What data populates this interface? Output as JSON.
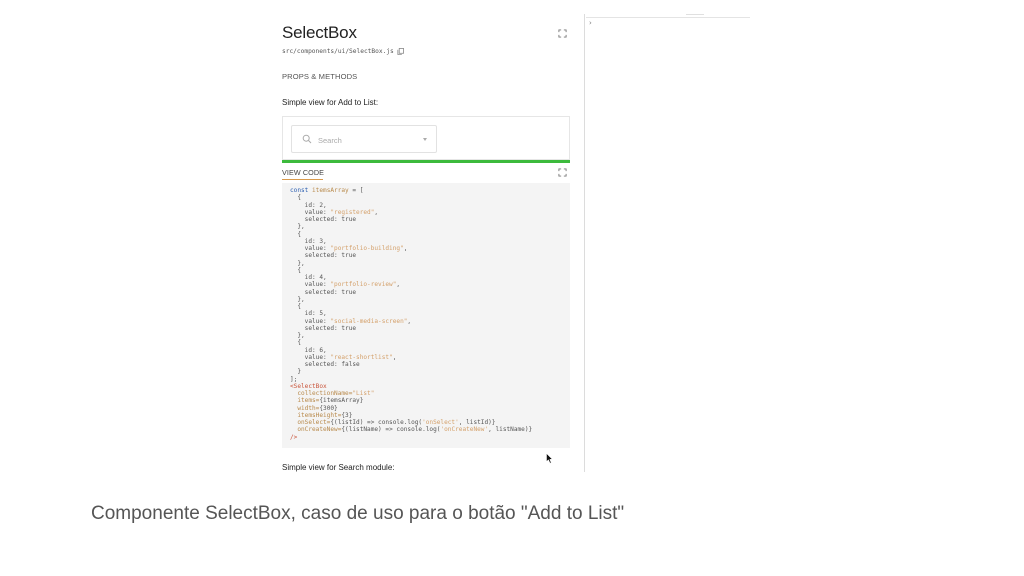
{
  "screenshot": {
    "component_title": "SelectBox",
    "source_path": "src/components/ui/SelectBox.js",
    "props_label": "PROPS & METHODS",
    "example_title": "Simple view for Add to List:",
    "preview": {
      "search_placeholder": "Search"
    },
    "view_code_label": "VIEW CODE",
    "code_lines": [
      [
        {
          "t": "const ",
          "c": "kw"
        },
        {
          "t": "itemsArray",
          "c": "var"
        },
        {
          "t": " = ["
        }
      ],
      [
        {
          "t": "  {"
        }
      ],
      [
        {
          "t": "    id: 2,"
        }
      ],
      [
        {
          "t": "    value: "
        },
        {
          "t": "\"registered\"",
          "c": "str"
        },
        {
          "t": ","
        }
      ],
      [
        {
          "t": "    selected: true"
        }
      ],
      [
        {
          "t": "  },"
        }
      ],
      [
        {
          "t": "  {"
        }
      ],
      [
        {
          "t": "    id: 3,"
        }
      ],
      [
        {
          "t": "    value: "
        },
        {
          "t": "\"portfolio-building\"",
          "c": "str"
        },
        {
          "t": ","
        }
      ],
      [
        {
          "t": "    selected: true"
        }
      ],
      [
        {
          "t": "  },"
        }
      ],
      [
        {
          "t": "  {"
        }
      ],
      [
        {
          "t": "    id: 4,"
        }
      ],
      [
        {
          "t": "    value: "
        },
        {
          "t": "\"portfolio-review\"",
          "c": "str"
        },
        {
          "t": ","
        }
      ],
      [
        {
          "t": "    selected: true"
        }
      ],
      [
        {
          "t": "  },"
        }
      ],
      [
        {
          "t": "  {"
        }
      ],
      [
        {
          "t": "    id: 5,"
        }
      ],
      [
        {
          "t": "    value: "
        },
        {
          "t": "\"social-media-screen\"",
          "c": "str"
        },
        {
          "t": ","
        }
      ],
      [
        {
          "t": "    selected: true"
        }
      ],
      [
        {
          "t": "  },"
        }
      ],
      [
        {
          "t": "  {"
        }
      ],
      [
        {
          "t": "    id: 6,"
        }
      ],
      [
        {
          "t": "    value: "
        },
        {
          "t": "\"react-shortlist\"",
          "c": "str"
        },
        {
          "t": ","
        }
      ],
      [
        {
          "t": "    selected: false"
        }
      ],
      [
        {
          "t": "  }"
        }
      ],
      [
        {
          "t": "];"
        }
      ],
      [
        {
          "t": "<SelectBox",
          "c": "tag"
        }
      ],
      [
        {
          "t": "  collectionName=",
          "c": "attr"
        },
        {
          "t": "\"List\"",
          "c": "str"
        }
      ],
      [
        {
          "t": "  items=",
          "c": "attr"
        },
        {
          "t": "{itemsArray}"
        }
      ],
      [
        {
          "t": "  width=",
          "c": "attr"
        },
        {
          "t": "{300}"
        }
      ],
      [
        {
          "t": "  itemsHeight=",
          "c": "attr"
        },
        {
          "t": "{3}"
        }
      ],
      [
        {
          "t": "  onSelect=",
          "c": "attr"
        },
        {
          "t": "{(listId) => console.log("
        },
        {
          "t": "'onSelect'",
          "c": "str"
        },
        {
          "t": ", listId)}"
        }
      ],
      [
        {
          "t": "  onCreateNew=",
          "c": "attr"
        },
        {
          "t": "{(listName) => console.log("
        },
        {
          "t": "'onCreateNew'",
          "c": "str"
        },
        {
          "t": ", listName)}"
        }
      ],
      [
        {
          "t": "/>",
          "c": "tag"
        }
      ]
    ],
    "next_example_title": "Simple view for Search module:",
    "right_pane_arrow": "›"
  },
  "caption": "Componente SelectBox, caso de uso para o botão \"Add to List\"",
  "icons": {
    "fullscreen": "fullscreen-icon",
    "copy": "copy-icon",
    "search": "search-icon",
    "dropdown": "chevron-down-icon",
    "cursor": "mouse-pointer-icon"
  },
  "colors": {
    "accent_green": "#3cba3c",
    "tab_underline": "#d89a4c",
    "code_background": "#f4f4f4"
  }
}
